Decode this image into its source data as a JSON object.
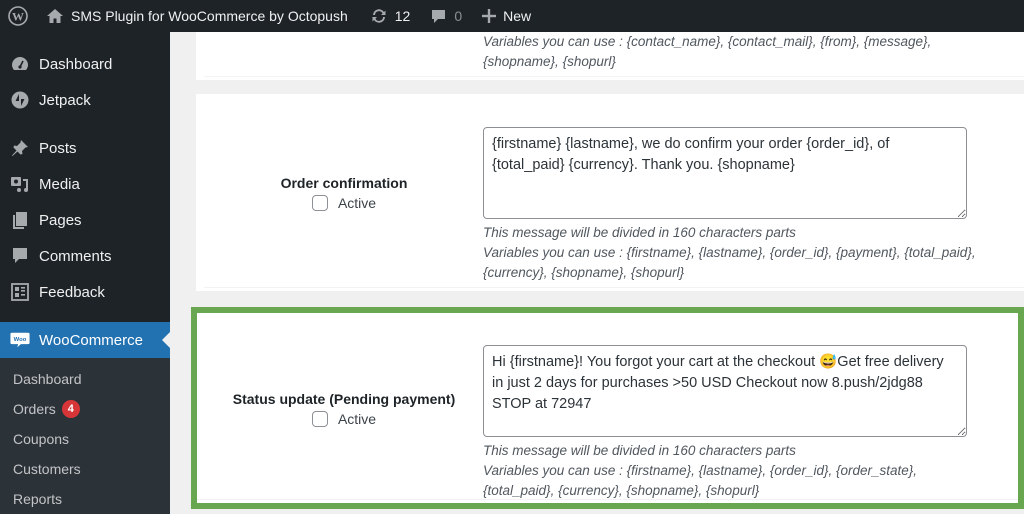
{
  "adminbar": {
    "site_title": "SMS Plugin for WooCommerce by Octopush",
    "updates_count": "12",
    "comments_count": "0",
    "new_label": "New",
    "icons": [
      "wordpress-logo-icon",
      "home-icon",
      "updates-icon",
      "comment-icon",
      "plus-icon"
    ]
  },
  "sidebar": {
    "items": [
      {
        "label": "Dashboard",
        "icon": "dashboard-icon"
      },
      {
        "label": "Jetpack",
        "icon": "jetpack-icon"
      },
      {
        "label": "Posts",
        "icon": "pin-icon"
      },
      {
        "label": "Media",
        "icon": "media-icon"
      },
      {
        "label": "Pages",
        "icon": "pages-icon"
      },
      {
        "label": "Comments",
        "icon": "comments-icon"
      },
      {
        "label": "Feedback",
        "icon": "feedback-icon"
      },
      {
        "label": "WooCommerce",
        "icon": "woo-icon",
        "current": true
      }
    ],
    "submenu": [
      {
        "label": "Dashboard"
      },
      {
        "label": "Orders",
        "badge": "4"
      },
      {
        "label": "Coupons"
      },
      {
        "label": "Customers"
      },
      {
        "label": "Reports"
      }
    ]
  },
  "main": {
    "top_partial": {
      "variables_line1": "Variables you can use : {contact_name}, {contact_mail}, {from}, {message},",
      "variables_line2": "{shopname}, {shopurl}"
    },
    "order_confirmation": {
      "title": "Order confirmation",
      "active_label": "Active",
      "active_checked": false,
      "message": "{firstname} {lastname}, we do confirm your order {order_id}, of {total_paid} {currency}. Thank you. {shopname}",
      "help_parts": "This message will be divided in 160 characters parts",
      "variables_line1": "Variables you can use : {firstname}, {lastname}, {order_id}, {payment}, {total_paid},",
      "variables_line2": "{currency}, {shopname}, {shopurl}"
    },
    "status_update": {
      "title": "Status update (Pending payment)",
      "active_label": "Active",
      "active_checked": false,
      "message": "Hi {firstname}! You forgot your cart at the checkout 😅Get free delivery in just 2 days for purchases >50 USD Checkout now 8.push/2jdg88 STOP at 72947",
      "help_parts": "This message will be divided in 160 characters parts",
      "variables_line1": "Variables you can use : {firstname}, {lastname}, {order_id}, {order_state},",
      "variables_line2": "{total_paid}, {currency}, {shopname}, {shopurl}",
      "highlight_color": "#68a74f"
    }
  }
}
